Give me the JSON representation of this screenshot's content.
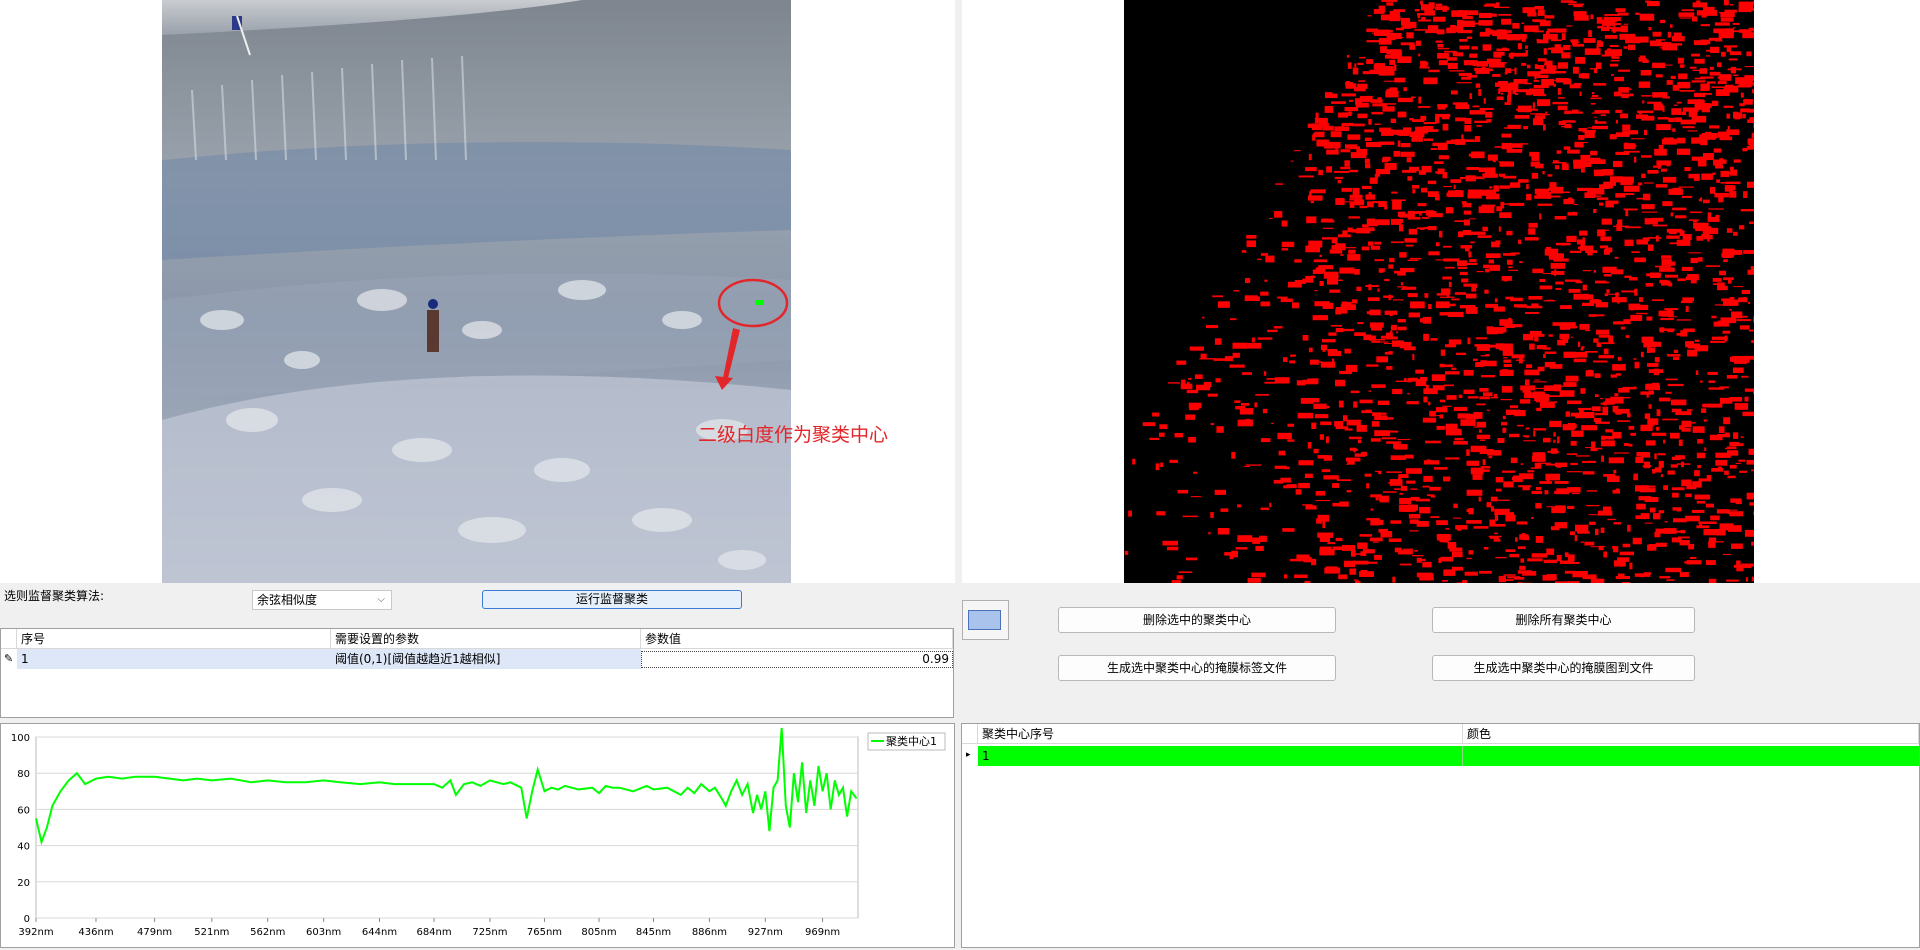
{
  "annotation": {
    "text": "二级白度作为聚类中心"
  },
  "form": {
    "algo_label": "选则监督聚类算法:",
    "algo_selected": "余弦相似度",
    "run_button": "运行监督聚类"
  },
  "param_grid": {
    "headers": [
      "序号",
      "需要设置的参数",
      "参数值"
    ],
    "rows": [
      {
        "index": "1",
        "param": "阈值(0,1)[阈值越趋近1越相似]",
        "value": "0.99"
      }
    ]
  },
  "actions": {
    "delete_selected": "删除选中的聚类中心",
    "delete_all": "删除所有聚类中心",
    "gen_label_file": "生成选中聚类中心的掩膜标签文件",
    "gen_mask_image": "生成选中聚类中心的掩膜图到文件"
  },
  "cluster_grid": {
    "headers": [
      "聚类中心序号",
      "颜色"
    ],
    "rows": [
      {
        "index": "1",
        "color": "#00ff00"
      }
    ]
  },
  "chart_data": {
    "type": "line",
    "x_ticks": [
      "392nm",
      "436nm",
      "479nm",
      "521nm",
      "562nm",
      "603nm",
      "644nm",
      "684nm",
      "725nm",
      "765nm",
      "805nm",
      "845nm",
      "886nm",
      "927nm",
      "969nm"
    ],
    "ylim": [
      0,
      100
    ],
    "y_ticks": [
      0,
      20,
      40,
      60,
      80,
      100
    ],
    "grid": true,
    "legend_position": "top-right",
    "series": [
      {
        "name": "聚类中心1",
        "color": "#00ff00",
        "x": [
          392,
          396,
          400,
          404,
          410,
          416,
          422,
          428,
          436,
          445,
          455,
          465,
          479,
          490,
          500,
          510,
          521,
          535,
          550,
          562,
          575,
          590,
          603,
          615,
          630,
          644,
          655,
          670,
          684,
          690,
          696,
          700,
          706,
          712,
          718,
          725,
          730,
          735,
          740,
          748,
          752,
          756,
          760,
          765,
          770,
          775,
          780,
          790,
          800,
          805,
          810,
          815,
          820,
          830,
          840,
          845,
          855,
          865,
          870,
          875,
          880,
          886,
          890,
          895,
          898,
          902,
          906,
          910,
          914,
          918,
          921,
          924,
          927,
          930,
          933,
          936,
          939,
          942,
          945,
          948,
          951,
          954,
          957,
          960,
          963,
          966,
          969,
          972,
          975,
          978,
          981,
          984,
          987,
          990,
          994
        ],
        "y": [
          55,
          42,
          50,
          62,
          70,
          76,
          80,
          74,
          77,
          78,
          77,
          78,
          78,
          77,
          76,
          77,
          76,
          77,
          75,
          76,
          75,
          75,
          76,
          75,
          74,
          75,
          74,
          74,
          74,
          72,
          76,
          68,
          74,
          75,
          73,
          76,
          75,
          74,
          75,
          72,
          55,
          70,
          82,
          70,
          72,
          71,
          73,
          71,
          72,
          69,
          73,
          72,
          72,
          70,
          73,
          71,
          72,
          68,
          72,
          69,
          74,
          70,
          72,
          66,
          62,
          70,
          76,
          68,
          74,
          58,
          68,
          60,
          70,
          48,
          72,
          76,
          105,
          62,
          50,
          80,
          64,
          86,
          58,
          76,
          62,
          84,
          70,
          80,
          60,
          76,
          68,
          72,
          56,
          70,
          66
        ]
      }
    ]
  }
}
